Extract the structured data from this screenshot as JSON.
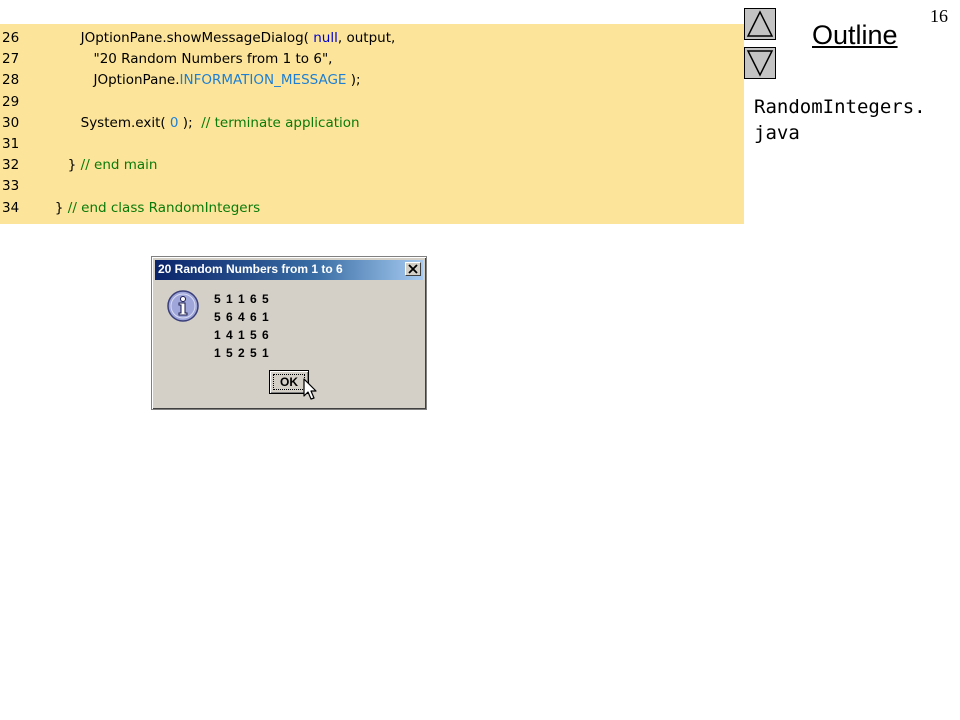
{
  "slide": {
    "page_number": "16",
    "outline_title": "Outline",
    "file_name": "RandomIntegers.\njava"
  },
  "code": {
    "lines": [
      {
        "num": "26",
        "indent": "         ",
        "parts": [
          {
            "t": "JOptionPane.showMessageDialog( ",
            "c": "plain"
          },
          {
            "t": "null",
            "c": "kw"
          },
          {
            "t": ", output,",
            "c": "plain"
          }
        ]
      },
      {
        "num": "27",
        "indent": "            ",
        "parts": [
          {
            "t": "\"20 Random Numbers from 1 to 6\",",
            "c": "str"
          }
        ]
      },
      {
        "num": "28",
        "indent": "            ",
        "parts": [
          {
            "t": "JOptionPane.",
            "c": "plain"
          },
          {
            "t": "INFORMATION_MESSAGE",
            "c": "const"
          },
          {
            "t": " );",
            "c": "plain"
          }
        ]
      },
      {
        "num": "29",
        "indent": "",
        "parts": []
      },
      {
        "num": "30",
        "indent": "         ",
        "parts": [
          {
            "t": "System.exit( ",
            "c": "plain"
          },
          {
            "t": "0",
            "c": "const"
          },
          {
            "t": " );  ",
            "c": "plain"
          },
          {
            "t": "// terminate application",
            "c": "cmt"
          }
        ]
      },
      {
        "num": "31",
        "indent": "",
        "parts": []
      },
      {
        "num": "32",
        "indent": "      ",
        "parts": [
          {
            "t": "} ",
            "c": "plain"
          },
          {
            "t": "// end main",
            "c": "cmt"
          }
        ]
      },
      {
        "num": "33",
        "indent": "",
        "parts": []
      },
      {
        "num": "34",
        "indent": "   ",
        "parts": [
          {
            "t": "} ",
            "c": "plain"
          },
          {
            "t": "// end class RandomIntegers",
            "c": "cmt"
          }
        ]
      }
    ]
  },
  "dialog": {
    "title": "20 Random Numbers from 1 to 6",
    "rows": [
      "5 1 1 6 5",
      "5 6 4 6 1",
      "1 4 1 5 6",
      "1 5 2 5 1"
    ],
    "ok_label": "OK",
    "icon": "information-icon"
  },
  "colors": {
    "code_background": "#fce59a",
    "keyword": "#0000cc",
    "constant": "#1d7ed4",
    "comment": "#0a7a0a"
  }
}
